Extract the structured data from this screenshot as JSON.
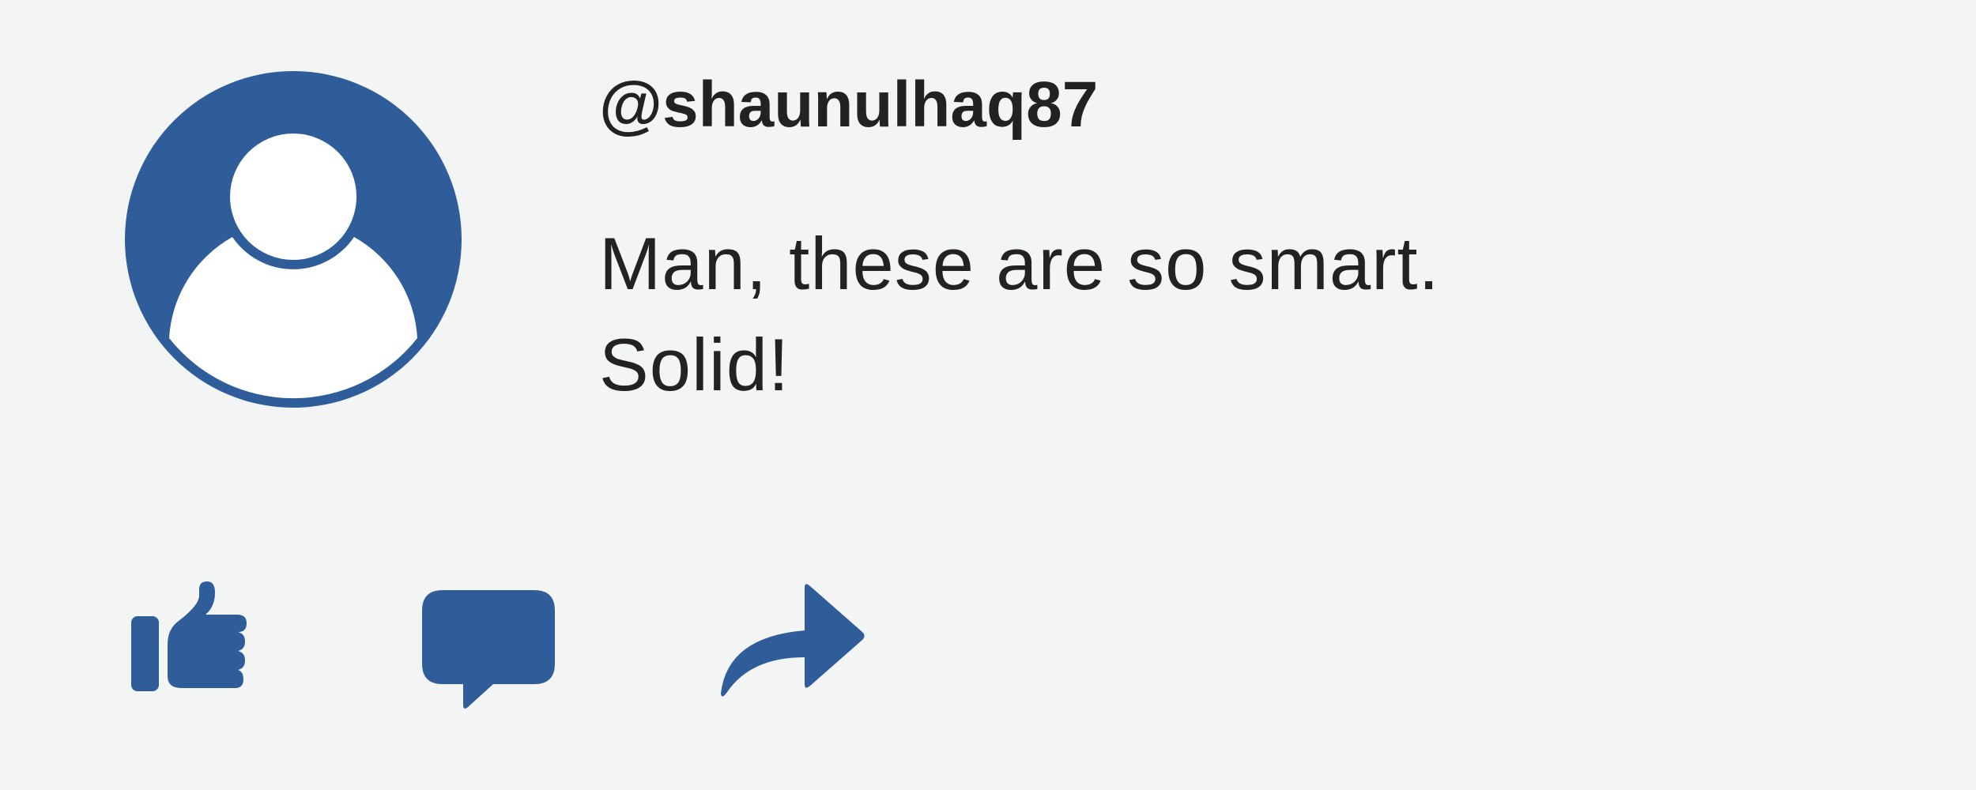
{
  "post": {
    "username": "@shaunulhaq87",
    "comment_text": "Man, these are so smart. Solid!"
  },
  "avatar": {
    "icon": "default-user-avatar-icon"
  },
  "actions": [
    {
      "name": "like",
      "icon": "thumbs-up-icon"
    },
    {
      "name": "comment",
      "icon": "speech-bubble-icon"
    },
    {
      "name": "share",
      "icon": "share-arrow-icon"
    }
  ],
  "colors": {
    "accent": "#2f5d99",
    "background": "#f3f4f4",
    "text": "#222222",
    "avatar_figure": "#ffffff"
  }
}
